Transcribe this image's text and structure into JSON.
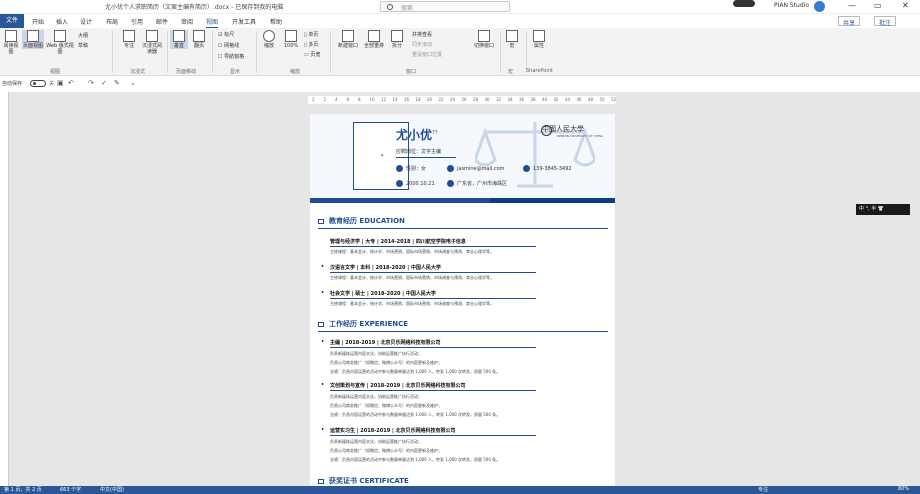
{
  "titlebar": {
    "doc_title": "尤小优个人求职简历（文案主编有简历）.docx - 已保存到我的电脑",
    "search_placeholder": "搜索",
    "user": "PIAN Studio",
    "min": "—",
    "max": "▭",
    "close": "✕"
  },
  "tabs": {
    "file": "文件",
    "items": [
      "开始",
      "插入",
      "设计",
      "布局",
      "引用",
      "邮件",
      "审阅",
      "视图",
      "开发工具",
      "帮助"
    ],
    "active_index": 7,
    "share": "共享",
    "comment": "批注"
  },
  "ribbon": {
    "views": [
      "阅读视图",
      "页面视图",
      "Web 版式视图"
    ],
    "outline": "大纲",
    "draft": "草稿",
    "views_label": "视图",
    "immersive": [
      "专注",
      "沉浸式阅读器"
    ],
    "immersive_label": "沉浸式",
    "move": [
      "垂直",
      "翻页"
    ],
    "move_label": "页面移动",
    "show": [
      "标尺",
      "网格线",
      "导航窗格"
    ],
    "show_label": "显示",
    "zoom": [
      "缩放",
      "100%"
    ],
    "zoom_pages": [
      "单页",
      "多页",
      "页宽"
    ],
    "zoom_label": "缩放",
    "window": [
      "新建窗口",
      "全部重排",
      "拆分"
    ],
    "window_small": [
      "并排查看",
      "同步滚动",
      "重设窗口位置"
    ],
    "switch": "切换窗口",
    "window_label": "窗口",
    "macro": "宏",
    "macro_label": "宏",
    "prop": "属性",
    "sp_label": "SharePoint"
  },
  "qat": {
    "autosave": "自动保存",
    "state": "关",
    "icons": [
      "save-icon",
      "undo-icon",
      "redo-icon",
      "spelling-icon",
      "draw-icon",
      "customize-icon"
    ]
  },
  "ruler": {
    "ticks": [
      "2",
      "2",
      "4",
      "6",
      "8",
      "10",
      "12",
      "14",
      "16",
      "18",
      "20",
      "22",
      "24",
      "26",
      "28",
      "30",
      "32",
      "34",
      "36",
      "38",
      "40",
      "42",
      "44",
      "46",
      "48",
      "50",
      "52"
    ]
  },
  "resume": {
    "photo_label": "✦",
    "name": "尤小优",
    "name_sup": "??",
    "job": "应聘岗位：文字主编",
    "contacts": [
      {
        "icon": "user-icon",
        "text": "性别：女"
      },
      {
        "icon": "mail-icon",
        "text": "jasmine@mail.com"
      },
      {
        "icon": "phone-icon",
        "text": "139-3845-3492"
      },
      {
        "icon": "calendar-icon",
        "text": "2000.10.21"
      },
      {
        "icon": "location-icon",
        "text": "广东省，广州市海珠区"
      }
    ],
    "logo": "中國人民大學",
    "logo_sub": "RENMIN UNIVERSITY OF CHINA",
    "sections": [
      {
        "title": "教育经历 EDUCATION",
        "entries": [
          {
            "head": "管理与经济学 | 大专 | 2014-2018 | 四川航空学院电子信息",
            "lines": [
              "主修课程：基本会计、统计学、市场营销、国际市场营销、市场调查与预测、商业心理学等。"
            ]
          },
          {
            "head": "汉语言文学 | 本科 | 2018-2020 | 中国人民大学",
            "lines": [
              "主修课程：基本会计、统计学、市场营销、国际市场营销、市场调查与预测、商业心理学等。"
            ]
          },
          {
            "head": "社会文学 | 硕士 | 2018-2020 | 中国人民大学",
            "lines": [
              "主修课程：基本会计、统计学、市场营销、国际市场营销、市场调查与预测、商业心理学等。"
            ]
          }
        ]
      },
      {
        "title": "工作经历 EXPERIENCE",
        "entries": [
          {
            "head": "主编 | 2018-2019 | 北京贝乐网络科技有限公司",
            "lines": [
              "负责新媒体运营内容文化，协助运营推广执行活动；",
              "负责公司商务推广（如微信、微博公众号）的内容更新及维护；",
              "业绩：负责内容运营的活动中参与数量单量达到 1,000 人，转发 1,000 次转发，质量 500 条。"
            ]
          },
          {
            "head": "文创策划与宣传 | 2018-2019 | 北京贝乐网络科技有限公司",
            "lines": [
              "负责新媒体运营内容文化，协助运营推广执行活动；",
              "负责公司商务推广（如微信、微博公众号）的内容更新及维护；",
              "业绩：负责内容运营的活动中参与数量单量达到 1,000 人，转发 1,000 次转发，质量 500 条。"
            ]
          },
          {
            "head": "运营实习生 | 2018-2019 | 北京贝乐网络科技有限公司",
            "lines": [
              "负责新媒体运营内容文化，协助运营推广执行活动；",
              "负责公司商务推广（如微信、微博公众号）的内容更新及维护；",
              "业绩：负责内容运营的活动中参与数量单量达到 1,000 人，转发 1,000 次转发，质量 500 条。"
            ]
          }
        ]
      },
      {
        "title": "获奖证书 CERTIFICATE",
        "entries": []
      }
    ]
  },
  "tooltip": {
    "text": "中 °, 半 👕"
  },
  "statusbar": {
    "page": "第 1 页，共 2 页",
    "words": "663 个字",
    "lang": "中文(中国)",
    "focus": "专注",
    "zoom": "80%"
  },
  "colors": {
    "accent": "#2b579a",
    "resume_blue": "#1f4e96"
  }
}
